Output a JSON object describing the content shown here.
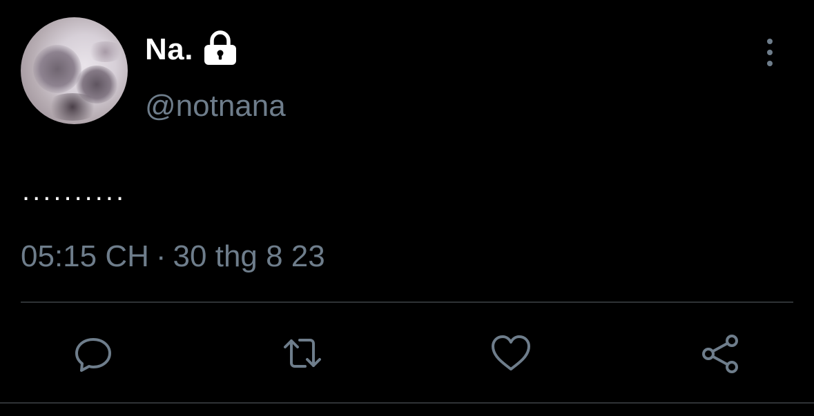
{
  "tweet": {
    "author": {
      "display_name": "Na.",
      "handle": "@notnana",
      "protected_icon": "lock-icon",
      "avatar": "blurred-cat-photo"
    },
    "text": "..........",
    "timestamp": {
      "time": "05:15 CH",
      "separator": "·",
      "date": "30 thg 8 23"
    },
    "menu_icon": "more-vertical-icon",
    "actions": [
      {
        "icon": "reply-icon"
      },
      {
        "icon": "retweet-icon"
      },
      {
        "icon": "like-icon"
      },
      {
        "icon": "share-icon"
      }
    ]
  },
  "colors": {
    "background": "#000000",
    "primary_text": "#ffffff",
    "secondary_text": "#6e7d8b",
    "divider": "#2f3336"
  }
}
